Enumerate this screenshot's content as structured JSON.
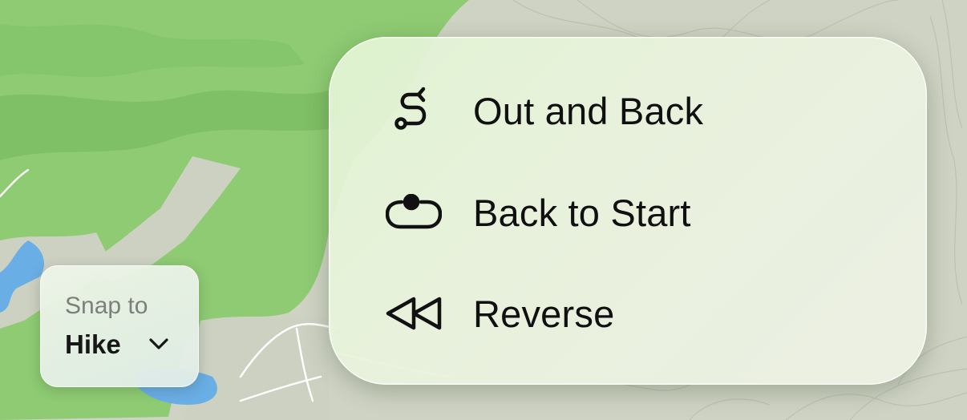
{
  "route_menu": {
    "items": [
      {
        "label": "Out and Back",
        "icon": "out-and-back-route-icon"
      },
      {
        "label": "Back to Start",
        "icon": "loop-route-icon"
      },
      {
        "label": "Reverse",
        "icon": "rewind-icon"
      }
    ]
  },
  "snap": {
    "caption": "Snap to",
    "value": "Hike",
    "icon": "chevron-down-icon"
  },
  "colors": {
    "forest": "#8ecb73",
    "forest_dark": "#7dbd63",
    "terrain": "#cdd1c2",
    "water": "#6aaee6",
    "icon": "#111111"
  }
}
